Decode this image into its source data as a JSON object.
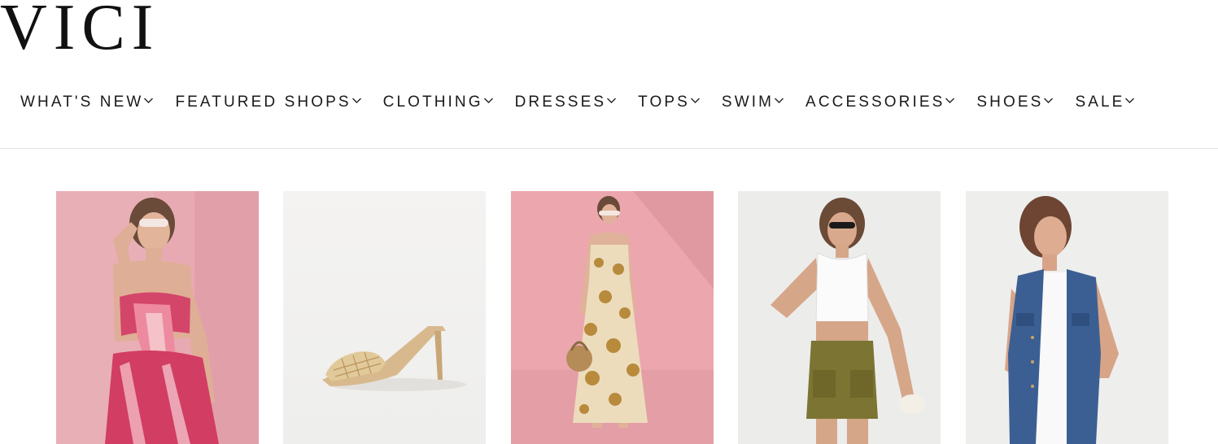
{
  "brand": {
    "logo_text": "VICI"
  },
  "nav": {
    "items": [
      {
        "label": "WHAT'S NEW"
      },
      {
        "label": "FEATURED SHOPS"
      },
      {
        "label": "CLOTHING"
      },
      {
        "label": "DRESSES"
      },
      {
        "label": "TOPS"
      },
      {
        "label": "SWIM"
      },
      {
        "label": "ACCESSORIES"
      },
      {
        "label": "SHOES"
      },
      {
        "label": "SALE"
      }
    ],
    "dropdown_icon": "chevron-down-icon"
  },
  "products": [
    {
      "image": "model-pink-tie-dye-two-piece",
      "background": "#e9aeb4"
    },
    {
      "image": "woven-heeled-mule",
      "background": "#f2f1ef"
    },
    {
      "image": "model-floral-maxi-dress",
      "background": "#eaa9ae"
    },
    {
      "image": "model-white-crop-top-olive-skort",
      "background": "#ededec"
    },
    {
      "image": "model-denim-vest",
      "background": "#eeeeed"
    }
  ]
}
